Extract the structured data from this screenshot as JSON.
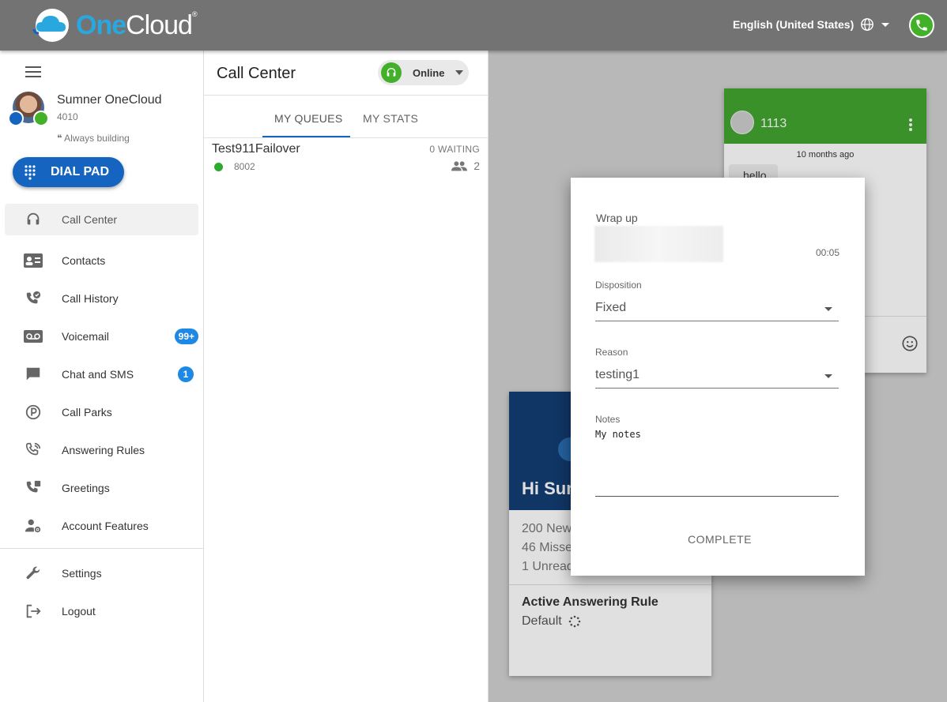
{
  "header": {
    "logo_one": "One",
    "logo_cloud": "Cloud",
    "logo_mark": "®",
    "language": "English (United States)"
  },
  "profile": {
    "name": "Sumner OneCloud",
    "extension": "4010",
    "status_quote": "❝",
    "status": "Always building"
  },
  "dial_pad_label": "DIAL PAD",
  "nav": [
    {
      "label": "Call Center",
      "icon": "headset-icon"
    },
    {
      "label": "Contacts",
      "icon": "contact-card-icon"
    },
    {
      "label": "Call History",
      "icon": "call-history-icon"
    },
    {
      "label": "Voicemail",
      "icon": "voicemail-icon",
      "badge": "99+"
    },
    {
      "label": "Chat and SMS",
      "icon": "chat-icon",
      "badge": "1"
    },
    {
      "label": "Call Parks",
      "icon": "parking-icon"
    },
    {
      "label": "Answering Rules",
      "icon": "answering-rules-icon"
    },
    {
      "label": "Greetings",
      "icon": "greetings-icon"
    },
    {
      "label": "Account Features",
      "icon": "account-features-icon"
    }
  ],
  "nav_bottom": [
    {
      "label": "Settings",
      "icon": "wrench-icon"
    },
    {
      "label": "Logout",
      "icon": "logout-icon"
    }
  ],
  "call_center": {
    "title": "Call Center",
    "status": "Online",
    "tabs": [
      "MY QUEUES",
      "MY STATS"
    ],
    "queue": {
      "name": "Test911Failover",
      "extension": "8002",
      "waiting": "0 WAITING",
      "agents": "2"
    }
  },
  "chat_card": {
    "number": "1113",
    "time": "10 months ago",
    "message": "hello"
  },
  "welcome_card": {
    "greeting": "Hi Sum",
    "stats": [
      "200 New",
      "46 Misse",
      "1 Unread"
    ],
    "rule_title": "Active Answering Rule",
    "rule_value": "Default"
  },
  "wrapup": {
    "title": "Wrap up",
    "timer": "00:05",
    "disposition_label": "Disposition",
    "disposition_value": "Fixed",
    "reason_label": "Reason",
    "reason_value": "testing1",
    "notes_label": "Notes",
    "notes_value": "My notes",
    "complete_label": "COMPLETE"
  },
  "colors": {
    "topbar": "#737373",
    "primary": "#1565c0",
    "online_green": "#43b02a",
    "badge_blue": "#1e88e5",
    "chat_header": "#43a52f",
    "welcome_header": "#133e73"
  }
}
